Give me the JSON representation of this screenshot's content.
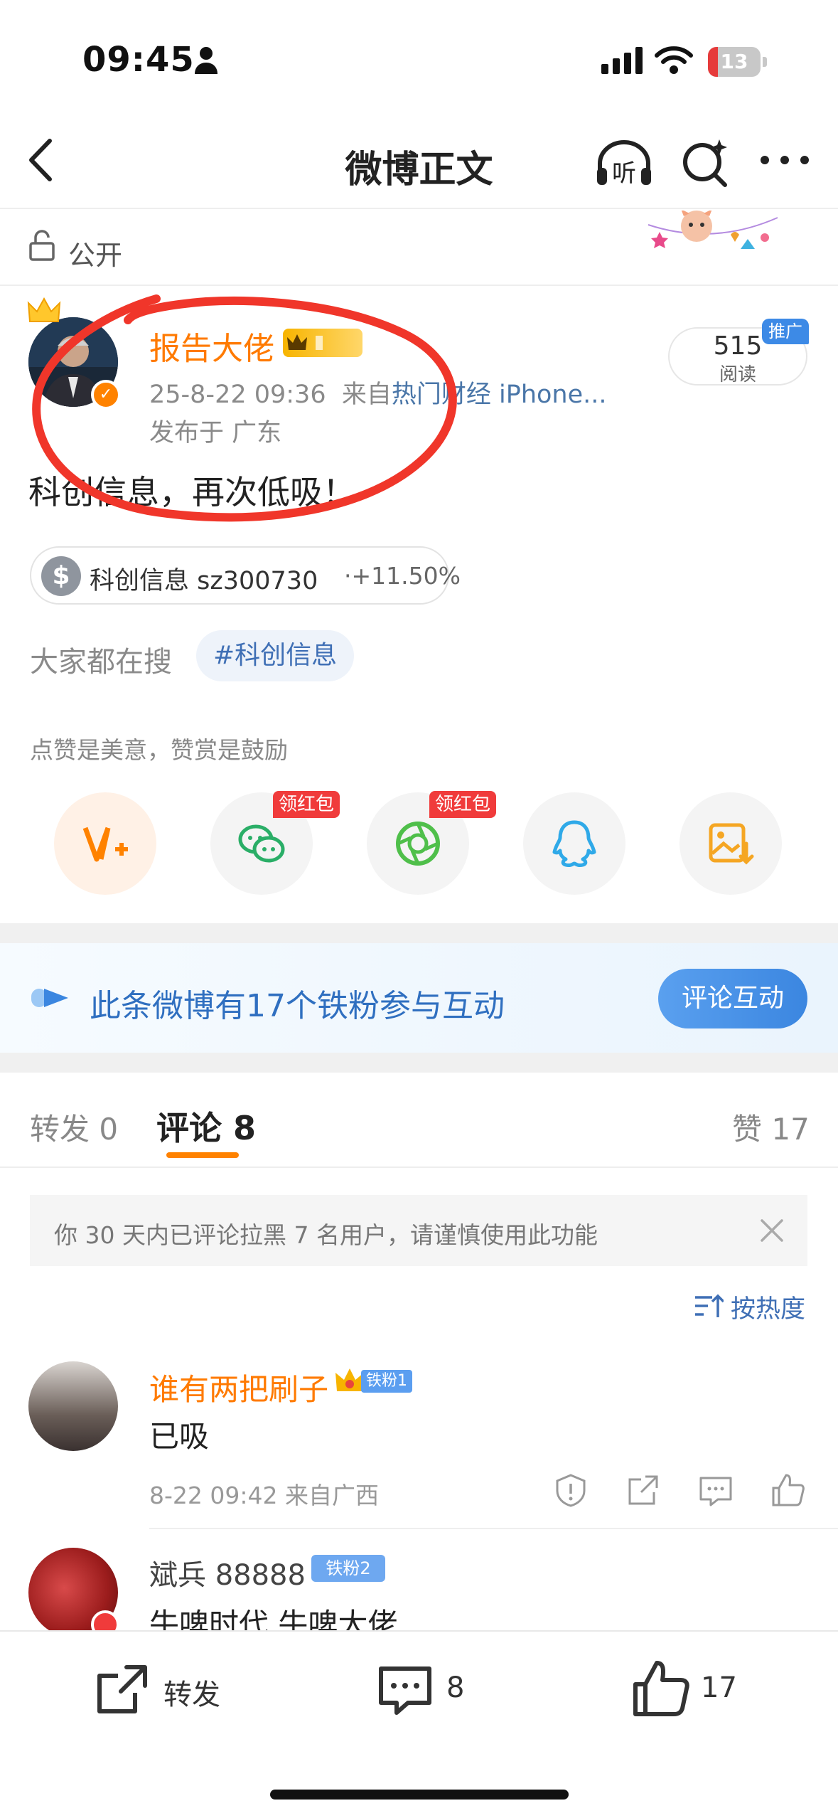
{
  "status_bar": {
    "time": "09:45",
    "battery": "13"
  },
  "nav": {
    "title": "微博正文",
    "listen_label": "听"
  },
  "visibility": {
    "label": "公开"
  },
  "post": {
    "author": "报告大佬",
    "time": "25-8-22 09:36",
    "source_prefix": "来自",
    "source": "热门财经 iPhone...",
    "location": "发布于 广东",
    "read_count": "515",
    "read_label": "阅读",
    "promo_tag": "推广",
    "text": "科创信息，再次低吸！",
    "stock": {
      "name": "科创信息 sz300730",
      "change": "·+11.50%"
    },
    "search_label": "大家都在搜",
    "hashtag": "#科创信息",
    "reward_hint": "点赞是美意，赞赏是鼓励",
    "red_packet_label": "领红包"
  },
  "fans_banner": {
    "text": "此条微博有17个铁粉参与互动",
    "button": "评论互动"
  },
  "tabs": {
    "repost": "转发 0",
    "comment": "评论 8",
    "like": "赞 17"
  },
  "notice": {
    "text": "你 30 天内已评论拉黑 7 名用户，请谨慎使用此功能"
  },
  "sort": {
    "label": "按热度"
  },
  "comments": [
    {
      "name": "谁有两把刷子",
      "badge": "铁粉1",
      "text": "已吸",
      "meta": "8-22 09:42  来自广西"
    },
    {
      "name": "斌兵 88888",
      "badge": "铁粉2",
      "text": "牛啤时代 牛啤大佬"
    }
  ],
  "bottom_bar": {
    "repost": "转发",
    "comment_count": "8",
    "like_count": "17"
  },
  "colors": {
    "accent": "#ff8200",
    "link": "#3f6fb5",
    "marker": "#f0362a"
  }
}
